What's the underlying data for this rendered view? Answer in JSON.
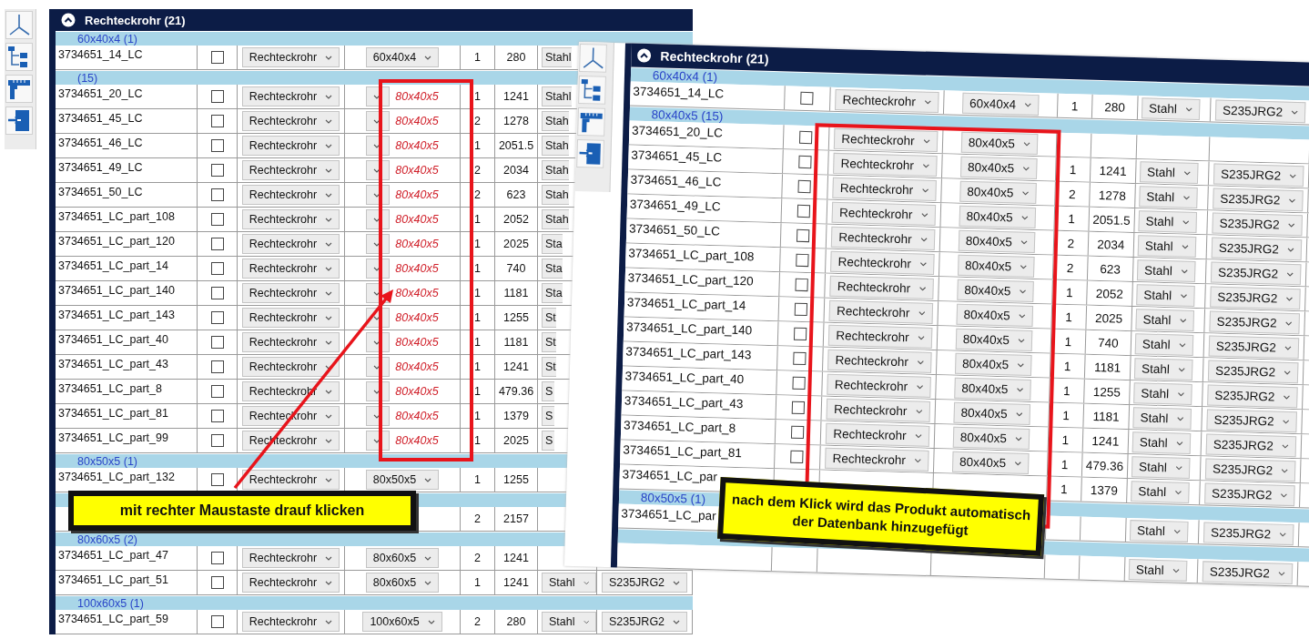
{
  "left_panel": {
    "header": {
      "title": "Rechteckrohr (21)",
      "expanded": true
    },
    "groups": [
      {
        "label": "60x40x4 (1)",
        "rows": [
          {
            "name": "3734651_14_LC",
            "checked": false,
            "type": "Rechteckrohr",
            "size": "60x40x4",
            "qty": "1",
            "length": "280",
            "material": "Stahl"
          }
        ]
      },
      {
        "label": "(15)",
        "rows": [
          {
            "name": "3734651_20_LC",
            "checked": false,
            "type": "Rechteckrohr",
            "size_preview": "80x40x5",
            "qty": "1",
            "length": "1241",
            "material": "Stahl"
          },
          {
            "name": "3734651_45_LC",
            "checked": false,
            "type": "Rechteckrohr",
            "size_preview": "80x40x5",
            "qty": "2",
            "length": "1278",
            "material": "Stah"
          },
          {
            "name": "3734651_46_LC",
            "checked": false,
            "type": "Rechteckrohr",
            "size_preview": "80x40x5",
            "qty": "1",
            "length": "2051.5",
            "material": "Stah"
          },
          {
            "name": "3734651_49_LC",
            "checked": false,
            "type": "Rechteckrohr",
            "size_preview": "80x40x5",
            "qty": "2",
            "length": "2034",
            "material": "Stah"
          },
          {
            "name": "3734651_50_LC",
            "checked": false,
            "type": "Rechteckrohr",
            "size_preview": "80x40x5",
            "qty": "2",
            "length": "623",
            "material": "Stah"
          },
          {
            "name": "3734651_LC_part_108",
            "checked": false,
            "type": "Rechteckrohr",
            "size_preview": "80x40x5",
            "qty": "1",
            "length": "2052",
            "material": "Stah"
          },
          {
            "name": "3734651_LC_part_120",
            "checked": false,
            "type": "Rechteckrohr",
            "size_preview": "80x40x5",
            "qty": "1",
            "length": "2025",
            "material": "Sta"
          },
          {
            "name": "3734651_LC_part_14",
            "checked": false,
            "type": "Rechteckrohr",
            "size_preview": "80x40x5",
            "qty": "1",
            "length": "740",
            "material": "Sta"
          },
          {
            "name": "3734651_LC_part_140",
            "checked": false,
            "type": "Rechteckrohr",
            "size_preview": "80x40x5",
            "qty": "1",
            "length": "1181",
            "material": "Sta"
          },
          {
            "name": "3734651_LC_part_143",
            "checked": false,
            "type": "Rechteckrohr",
            "size_preview": "80x40x5",
            "qty": "1",
            "length": "1255",
            "material": "St"
          },
          {
            "name": "3734651_LC_part_40",
            "checked": false,
            "type": "Rechteckrohr",
            "size_preview": "80x40x5",
            "qty": "1",
            "length": "1181",
            "material": "St"
          },
          {
            "name": "3734651_LC_part_43",
            "checked": false,
            "type": "Rechteckrohr",
            "size_preview": "80x40x5",
            "qty": "1",
            "length": "1241",
            "material": "St"
          },
          {
            "name": "3734651_LC_part_8",
            "checked": false,
            "type": "Rechteckrohr",
            "size_preview": "80x40x5",
            "qty": "1",
            "length": "479.36",
            "material": "S"
          },
          {
            "name": "3734651_LC_part_81",
            "checked": false,
            "type": "Rechteckrohr",
            "size_preview": "80x40x5",
            "qty": "1",
            "length": "1379",
            "material": "S"
          },
          {
            "name": "3734651_LC_part_99",
            "checked": false,
            "type": "Rechteckrohr",
            "size_preview": "80x40x5",
            "qty": "1",
            "length": "2025",
            "material": "S"
          }
        ]
      },
      {
        "label": "80x50x5 (1)",
        "rows": [
          {
            "name": "3734651_LC_part_132",
            "checked": false,
            "type": "Rechteckrohr",
            "size": "80x50x5",
            "qty": "1",
            "length": "1255"
          }
        ]
      },
      {
        "rows": [
          {
            "qty": "2",
            "length": "2157"
          }
        ]
      },
      {
        "label": "80x60x5 (2)",
        "rows": [
          {
            "name": "3734651_LC_part_47",
            "checked": false,
            "type": "Rechteckrohr",
            "size": "80x60x5",
            "qty": "2",
            "length": "1241"
          },
          {
            "name": "3734651_LC_part_51",
            "checked": false,
            "type": "Rechteckrohr",
            "size": "80x60x5",
            "qty": "1",
            "length": "1241",
            "material": "Stahl",
            "grade": "S235JRG2"
          }
        ]
      },
      {
        "label": "100x60x5 (1)",
        "rows": [
          {
            "name": "3734651_LC_part_59",
            "checked": false,
            "type": "Rechteckrohr",
            "size": "100x60x5",
            "qty": "2",
            "length": "280",
            "material": "Stahl",
            "grade": "S235JRG2"
          }
        ]
      }
    ],
    "callout": {
      "text": "mit rechter Maustaste drauf klicken"
    }
  },
  "right_panel": {
    "header": {
      "title": "Rechteckrohr (21)",
      "expanded": true
    },
    "groups": [
      {
        "label": "60x40x4 (1)",
        "rows": [
          {
            "name": "3734651_14_LC",
            "checked": false,
            "type": "Rechteckrohr",
            "size": "60x40x4",
            "qty": "1",
            "length": "280",
            "material": "Stahl",
            "grade": "S235JRG2"
          }
        ]
      },
      {
        "label": "80x40x5 (15)",
        "rows": [
          {
            "name": "3734651_20_LC",
            "checked": false,
            "type": "Rechteckrohr",
            "size": "80x40x5"
          },
          {
            "name": "3734651_45_LC",
            "checked": false,
            "type": "Rechteckrohr",
            "size": "80x40x5",
            "qty": "1",
            "length": "1241",
            "material": "Stahl",
            "grade": "S235JRG2"
          },
          {
            "name": "3734651_46_LC",
            "checked": false,
            "type": "Rechteckrohr",
            "size": "80x40x5",
            "qty": "2",
            "length": "1278",
            "material": "Stahl",
            "grade": "S235JRG2"
          },
          {
            "name": "3734651_49_LC",
            "checked": false,
            "type": "Rechteckrohr",
            "size": "80x40x5",
            "qty": "1",
            "length": "2051.5",
            "material": "Stahl",
            "grade": "S235JRG2"
          },
          {
            "name": "3734651_50_LC",
            "checked": false,
            "type": "Rechteckrohr",
            "size": "80x40x5",
            "qty": "2",
            "length": "2034",
            "material": "Stahl",
            "grade": "S235JRG2"
          },
          {
            "name": "3734651_LC_part_108",
            "checked": false,
            "type": "Rechteckrohr",
            "size": "80x40x5",
            "qty": "2",
            "length": "623",
            "material": "Stahl",
            "grade": "S235JRG2"
          },
          {
            "name": "3734651_LC_part_120",
            "checked": false,
            "type": "Rechteckrohr",
            "size": "80x40x5",
            "qty": "1",
            "length": "2052",
            "material": "Stahl",
            "grade": "S235JRG2"
          },
          {
            "name": "3734651_LC_part_14",
            "checked": false,
            "type": "Rechteckrohr",
            "size": "80x40x5",
            "qty": "1",
            "length": "2025",
            "material": "Stahl",
            "grade": "S235JRG2"
          },
          {
            "name": "3734651_LC_part_140",
            "checked": false,
            "type": "Rechteckrohr",
            "size": "80x40x5",
            "qty": "1",
            "length": "740",
            "material": "Stahl",
            "grade": "S235JRG2"
          },
          {
            "name": "3734651_LC_part_143",
            "checked": false,
            "type": "Rechteckrohr",
            "size": "80x40x5",
            "qty": "1",
            "length": "1181",
            "material": "Stahl",
            "grade": "S235JRG2"
          },
          {
            "name": "3734651_LC_part_40",
            "checked": false,
            "type": "Rechteckrohr",
            "size": "80x40x5",
            "qty": "1",
            "length": "1255",
            "material": "Stahl",
            "grade": "S235JRG2"
          },
          {
            "name": "3734651_LC_part_43",
            "checked": false,
            "type": "Rechteckrohr",
            "size": "80x40x5",
            "qty": "1",
            "length": "1181",
            "material": "Stahl",
            "grade": "S235JRG2"
          },
          {
            "name": "3734651_LC_part_8",
            "checked": false,
            "type": "Rechteckrohr",
            "size": "80x40x5",
            "qty": "1",
            "length": "1241",
            "material": "Stahl",
            "grade": "S235JRG2"
          },
          {
            "name": "3734651_LC_part_81",
            "checked": false,
            "type": "Rechteckrohr",
            "size": "80x40x5",
            "qty": "1",
            "length": "479.36",
            "material": "Stahl",
            "grade": "S235JRG2"
          },
          {
            "name": "3734651_LC_par",
            "qty": "1",
            "length": "1379",
            "material": "Stahl",
            "grade": "S235JRG2"
          }
        ]
      },
      {
        "label": "80x50x5 (1)",
        "rows": [
          {
            "name": "3734651_LC_par",
            "material": "Stahl",
            "grade": "S235JRG2"
          }
        ]
      },
      {
        "rows": [
          {
            "material": "Stahl",
            "grade": "S235JRG2"
          }
        ]
      }
    ],
    "callout": {
      "text": "nach dem Klick wird das Produkt automatisch der Datenbank hinzugefügt"
    }
  }
}
